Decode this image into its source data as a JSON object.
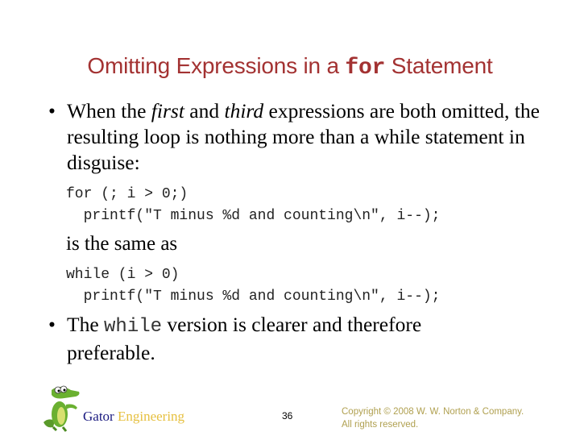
{
  "slide": {
    "title_pre": "Omitting Expressions in a ",
    "title_code": "for",
    "title_post": " Statement",
    "bullet1": {
      "marker": "•",
      "t1": "When the ",
      "em1": "first",
      "t2": " and ",
      "em2": "third",
      "t3": " expressions are both omitted, the resulting loop is nothing more than a while statement in disguise:"
    },
    "code1": [
      "for (; i > 0;)",
      "  printf(\"T minus %d and counting\\n\", i--);"
    ],
    "same_as": "is the same as",
    "code2": [
      "while (i > 0)",
      "  printf(\"T minus %d and counting\\n\", i--);"
    ],
    "bullet2": {
      "marker": "•",
      "t1": "The ",
      "code": "while",
      "t2": " version is clearer and therefore preferable."
    }
  },
  "footer": {
    "logo_icon": "alligator-mascot-icon",
    "brand_part1": "Gator",
    "brand_part2": "Engineering",
    "page_number": "36",
    "copyright_line1": "Copyright © 2008 W. W. Norton & Company.",
    "copyright_line2": "All rights reserved."
  }
}
